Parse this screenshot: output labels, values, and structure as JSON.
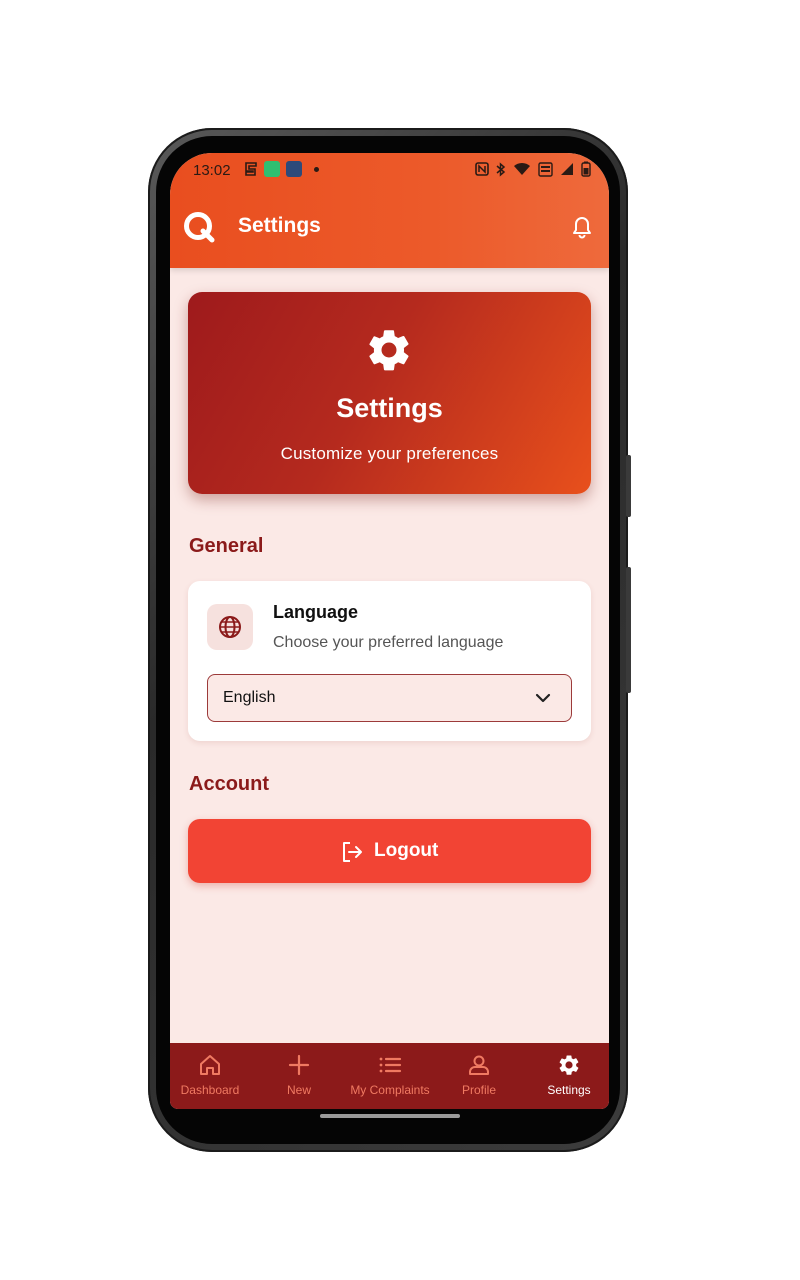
{
  "status": {
    "time": "13:02"
  },
  "header": {
    "title": "Settings"
  },
  "hero": {
    "title": "Settings",
    "subtitle": "Customize your preferences"
  },
  "general": {
    "title": "General",
    "language": {
      "title": "Language",
      "subtitle": "Choose your preferred language",
      "selected": "English"
    }
  },
  "account": {
    "title": "Account",
    "logout_label": "Logout"
  },
  "nav": {
    "items": [
      {
        "label": "Dashboard",
        "icon": "home-icon"
      },
      {
        "label": "New",
        "icon": "plus-icon"
      },
      {
        "label": "My Complaints",
        "icon": "list-icon"
      },
      {
        "label": "Profile",
        "icon": "person-icon"
      },
      {
        "label": "Settings",
        "icon": "gear-icon",
        "active": true
      }
    ]
  },
  "colors": {
    "accent": "#e94e1f",
    "nav_background": "#8c1a1a",
    "logout": "#f24434",
    "section_title": "#8b1a1a"
  }
}
